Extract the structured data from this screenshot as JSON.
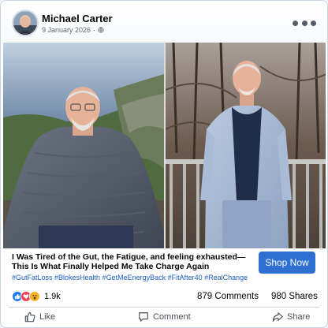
{
  "post": {
    "author": "Michael Carter",
    "date": "9 January 2026",
    "privacy_separator": "·",
    "privacy_icon": "globe-icon",
    "more_icon": "more-dots-icon"
  },
  "ad": {
    "headline": "I Was Tired of the Gut, the Fatigue, and feeling exhausted—This Is What Finally Helped Me Take Charge Again",
    "cta_label": "Shop Now",
    "hashtags": "#GutFatLoss #BlokesHealth #GetMeEnergyBack #FitAfter40 #RealChange"
  },
  "engagement": {
    "reactions": [
      "like",
      "love",
      "wow"
    ],
    "reaction_count": "1.9k",
    "comments": "879 Comments",
    "shares": "980 Shares"
  },
  "actions": {
    "like": "Like",
    "comment": "Comment",
    "share": "Share"
  },
  "colors": {
    "cta": "#2f6fd1",
    "hashtag": "#1b5fc4",
    "like": "#1877f2",
    "love": "#f33e58",
    "wow": "#f7b125"
  }
}
